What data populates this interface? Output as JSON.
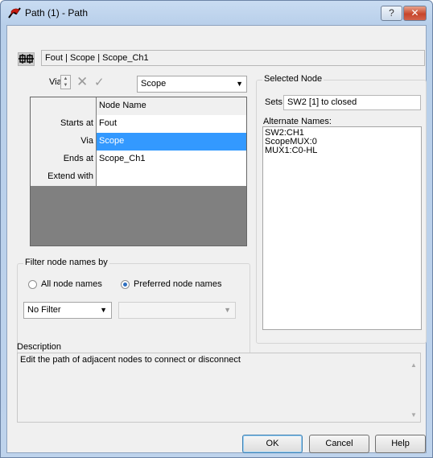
{
  "window": {
    "title": "Path (1) - Path",
    "help_label": "?",
    "close_label": "✕"
  },
  "path_bar": {
    "value": "Fout | Scope | Scope_Ch1",
    "icon": "path-node-icon"
  },
  "edit_row": {
    "via_label": "Via",
    "combo_value": "Scope"
  },
  "node_grid": {
    "column_header": "Node Name",
    "rows": [
      {
        "label": "Starts at",
        "value": "Fout"
      },
      {
        "label": "Via",
        "value": "Scope",
        "selected": true
      },
      {
        "label": "Ends at",
        "value": "Scope_Ch1"
      },
      {
        "label": "Extend with",
        "value": ""
      }
    ]
  },
  "filter": {
    "title": "Filter node names by",
    "all_label": "All node names",
    "preferred_label": "Preferred node names",
    "selected": "preferred",
    "filter_value": "No Filter",
    "second_value": ""
  },
  "selected_node": {
    "title": "Selected Node",
    "sets_label": "Sets",
    "sets_value": "SW2 [1] to closed",
    "alt_label": "Alternate Names:",
    "alt_names": [
      "SW2:CH1",
      "ScopeMUX:0",
      "MUX1:C0-HL"
    ]
  },
  "description": {
    "label": "Description",
    "text": "Edit the path of adjacent nodes to connect or disconnect"
  },
  "buttons": {
    "ok": "OK",
    "cancel": "Cancel",
    "help": "Help"
  },
  "colors": {
    "selection": "#3399ff",
    "grid_background": "#808080",
    "title_bar": "#bed3ec"
  }
}
